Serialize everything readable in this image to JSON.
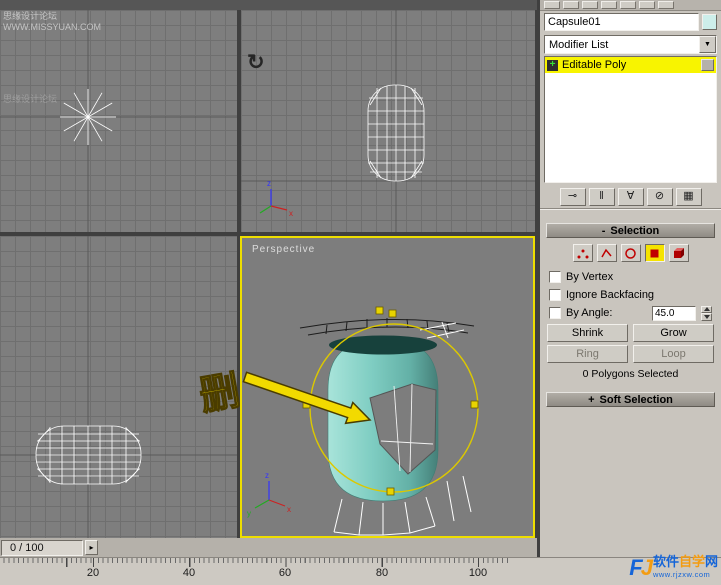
{
  "colors": {
    "viewport_bg": "#7e7e7e",
    "grid_line": "#6f6f6f",
    "panel_bg": "#c9c5be",
    "active_viewport_border": "#eede00",
    "modifier_highlight": "#f8f400",
    "capsule_teal": "#7fcdc2",
    "gizmo_yellow": "#dcc800",
    "subobject_red": "#cc0000",
    "logo_blue": "#1565d8",
    "logo_orange": "#f39c12"
  },
  "watermark": {
    "line1": "思缘设计论坛",
    "line2": "WWW.MISSYUAN.COM"
  },
  "viewports": {
    "perspective": {
      "label": "Perspective"
    },
    "axis": {
      "x": "x",
      "y": "y",
      "z": "z"
    },
    "rotate_icon": "↻"
  },
  "annotation": {
    "text": "删"
  },
  "panel": {
    "object_name": "Capsule01",
    "modifier_list": "Modifier List",
    "icons": {
      "dropdown_arrow": "▼"
    },
    "stack": {
      "expand": "+",
      "modifier": "Editable Poly"
    },
    "stack_tools": [
      {
        "name": "pin-stack",
        "glyph": "⊸"
      },
      {
        "name": "show-end-result",
        "glyph": "‖"
      },
      {
        "name": "make-unique",
        "glyph": "∀"
      },
      {
        "name": "remove-modifier",
        "glyph": "⊘"
      },
      {
        "name": "configure-modifier-sets",
        "glyph": "▦"
      }
    ],
    "selection": {
      "collapse_glyph": "-",
      "title": "Selection",
      "subobjects": [
        "vertex",
        "edge",
        "border",
        "polygon",
        "element"
      ],
      "active_subobject": "polygon",
      "by_vertex": "By Vertex",
      "ignore_backfacing": "Ignore Backfacing",
      "by_angle": "By Angle:",
      "angle_value": "45.0",
      "shrink": "Shrink",
      "grow": "Grow",
      "ring": "Ring",
      "loop": "Loop",
      "status": "0 Polygons Selected"
    },
    "soft_selection": {
      "expand_glyph": "+",
      "title": "Soft Selection"
    }
  },
  "timeline": {
    "frame_indicator": "0 / 100",
    "next_glyph": "▸",
    "ticks": [
      "20",
      "40",
      "60",
      "80",
      "100"
    ]
  },
  "logo": {
    "mark_f": "F",
    "mark_j": "J",
    "text_blue": "软件",
    "text_orange": "自学",
    "text_blue2": "网",
    "url": "www.rjzxw.com"
  }
}
